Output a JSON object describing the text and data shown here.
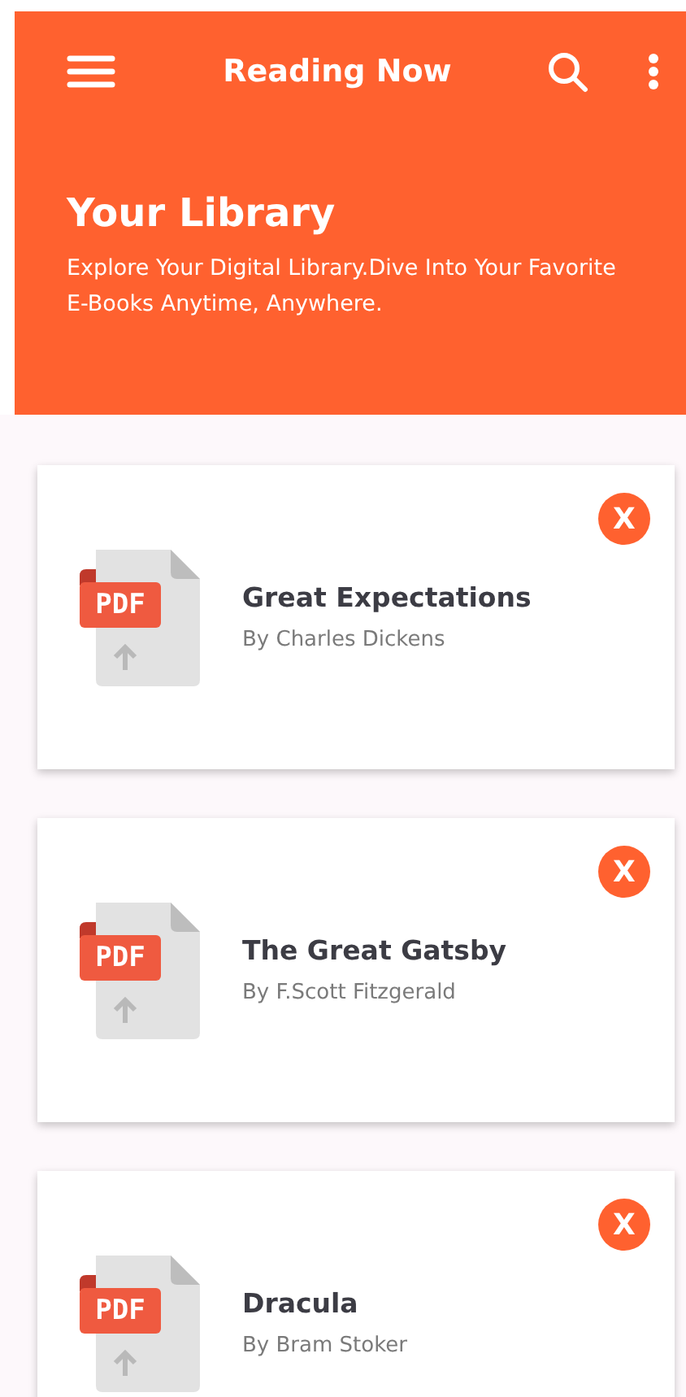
{
  "app_bar": {
    "title": "Reading Now"
  },
  "banner": {
    "heading": "Your Library",
    "description": "Explore Your Digital Library.Dive Into Your Favorite E-Books Anytime, Anywhere."
  },
  "books": [
    {
      "title": "Great Expectations",
      "author": "By Charles Dickens",
      "file_label": "PDF",
      "remove_label": "X"
    },
    {
      "title": "The Great Gatsby",
      "author": "By F.Scott Fitzgerald",
      "file_label": "PDF",
      "remove_label": "X"
    },
    {
      "title": "Dracula",
      "author": "By Bram Stoker",
      "file_label": "PDF",
      "remove_label": "X"
    }
  ]
}
